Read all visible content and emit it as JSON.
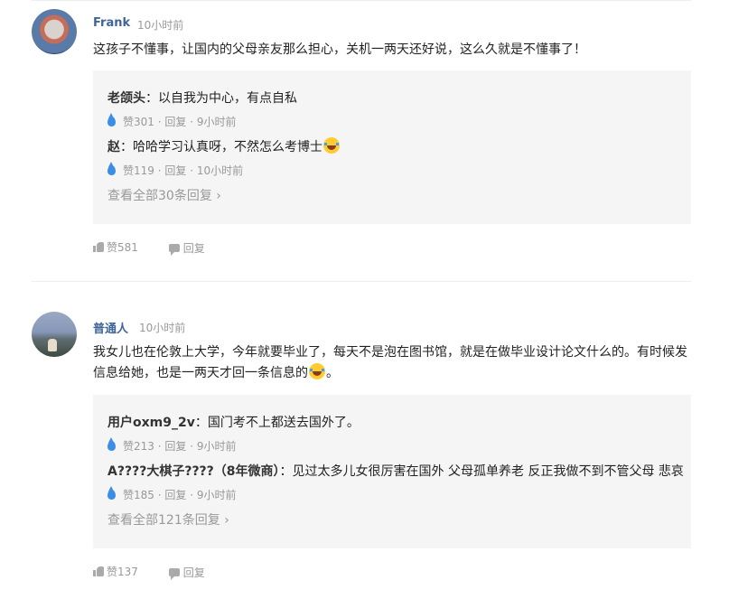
{
  "comments": [
    {
      "username": "Frank",
      "time": "10小时前",
      "content": "这孩子不懂事，让国内的父母亲友那么担心，关机一两天还好说，这么久就是不懂事了！",
      "replies": [
        {
          "name": "老颌头",
          "sep": "：",
          "text": "以自我为中心，有点自私",
          "likes": "赞301",
          "reply_label": "回复",
          "time": "9小时前"
        },
        {
          "name": "赵",
          "sep": "：",
          "text": "哈哈学习认真呀，不然怎么考博士",
          "emoji": "laugh-cry-emoji",
          "likes": "赞119",
          "reply_label": "回复",
          "time": "10小时前"
        }
      ],
      "view_all": "查看全部30条回复",
      "likes": "赞581",
      "reply_label": "回复"
    },
    {
      "username": "普通人",
      "time": "10小时前",
      "content": "我女儿也在伦敦上大学，今年就要毕业了，每天不是泡在图书馆，就是在做毕业设计论文什么的。有时候发信息给她，也是一两天才回一条信息的",
      "content_end": "。",
      "replies": [
        {
          "name": "用户oxm9_2v",
          "sep": "：",
          "text": "国门考不上都送去国外了。",
          "likes": "赞213",
          "reply_label": "回复",
          "time": "9小时前"
        },
        {
          "name": "A????大棋子????（8年微商）",
          "sep": "：",
          "text": "见过太多儿女很厉害在国外 父母孤单养老 反正我做不到不管父母 悲哀",
          "likes": "赞185",
          "reply_label": "回复",
          "time": "9小时前"
        }
      ],
      "view_all": "查看全部121条回复",
      "likes": "赞137",
      "reply_label": "回复"
    }
  ],
  "meta_separator": "·",
  "chevron": "›"
}
